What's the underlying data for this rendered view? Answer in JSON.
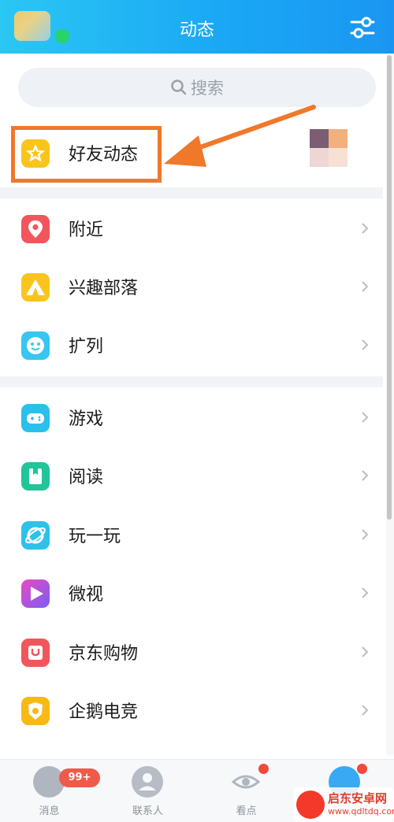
{
  "header": {
    "title": "动态"
  },
  "search": {
    "placeholder": "搜索"
  },
  "friends_feed": {
    "label": "好友动态"
  },
  "group1": [
    {
      "name": "nearby",
      "label": "附近",
      "icon": "location-pin-icon",
      "color": "#f1565c"
    },
    {
      "name": "interest-tribe",
      "label": "兴趣部落",
      "icon": "tent-icon",
      "color": "#f9c51c"
    },
    {
      "name": "expand-list",
      "label": "扩列",
      "icon": "chat-face-icon",
      "color": "#37c6f0"
    }
  ],
  "group2": [
    {
      "name": "games",
      "label": "游戏",
      "icon": "gamepad-icon",
      "color": "#2ac0ec"
    },
    {
      "name": "reading",
      "label": "阅读",
      "icon": "book-icon",
      "color": "#20c59a"
    },
    {
      "name": "play",
      "label": "玩一玩",
      "icon": "planet-icon",
      "color": "#2cc2ea"
    },
    {
      "name": "weishi",
      "label": "微视",
      "icon": "video-play-icon",
      "color": "#8c5cf3"
    },
    {
      "name": "jd-shopping",
      "label": "京东购物",
      "icon": "shopping-bag-icon",
      "color": "#f1565c"
    },
    {
      "name": "esports",
      "label": "企鹅电竞",
      "icon": "esports-icon",
      "color": "#f7b915"
    }
  ],
  "bottom_nav": [
    {
      "label": "消息"
    },
    {
      "label": "联系人"
    },
    {
      "label": "看点"
    },
    {
      "label": ""
    }
  ],
  "messages_badge": "99+",
  "watermark": {
    "title": "启东安卓网",
    "url": "www.qdltdq.com"
  }
}
